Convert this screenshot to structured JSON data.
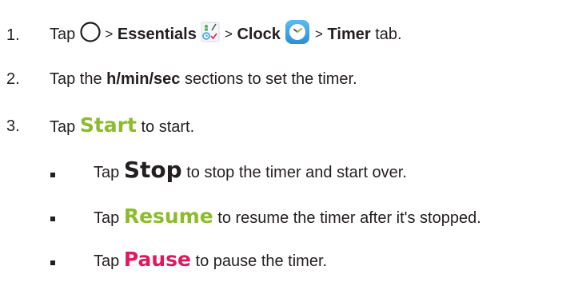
{
  "steps": [
    {
      "num": "1.",
      "tap": "Tap",
      "sep1": ">",
      "essentials": "Essentials",
      "sep2": ">",
      "clock": "Clock",
      "sep3": ">",
      "timer": "Timer",
      "tab": "tab."
    },
    {
      "num": "2.",
      "tap": "Tap the",
      "hms": "h/min/sec",
      "rest": "sections to set the timer."
    },
    {
      "num": "3.",
      "tap": "Tap",
      "keyword": "Start",
      "rest": "to start."
    }
  ],
  "bullets": [
    {
      "tap": "Tap",
      "keyword": "Stop",
      "rest": "to stop the timer and start over."
    },
    {
      "tap": "Tap",
      "keyword": "Resume",
      "rest": "to resume the timer after it's stopped."
    },
    {
      "tap": "Tap",
      "keyword": "Pause",
      "rest": "to pause the timer."
    }
  ],
  "colors": {
    "text": "#231f20",
    "start": "#8dbb2e",
    "resume": "#8dbb2e",
    "pause": "#e5175b",
    "clock_icon": "#3a9fe0"
  },
  "icons": [
    "home-circle-icon",
    "essentials-icon",
    "clock-icon"
  ]
}
